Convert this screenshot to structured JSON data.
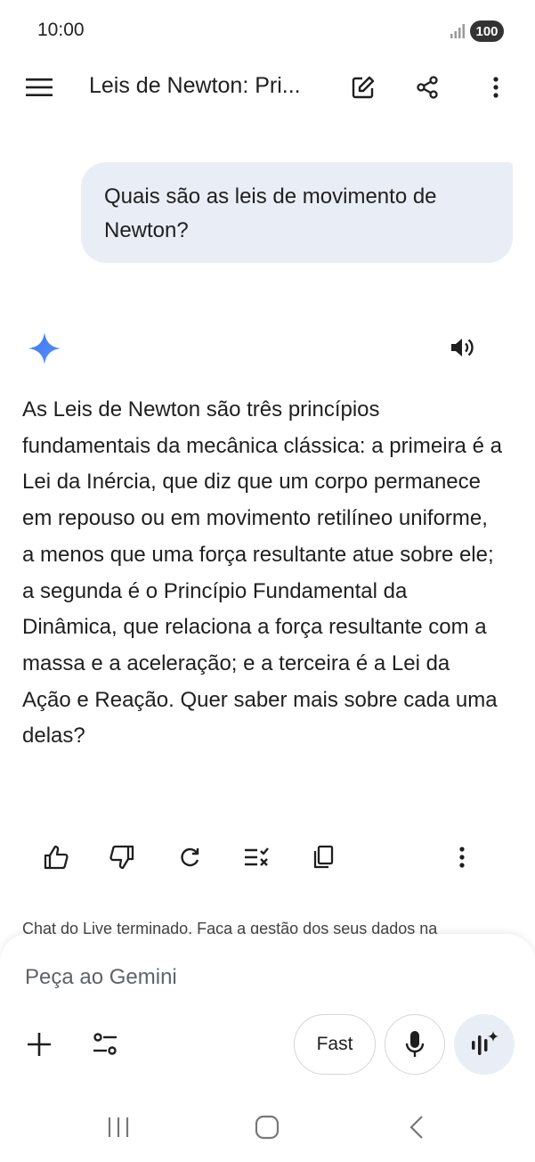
{
  "status_bar": {
    "time": "10:00",
    "battery": "100"
  },
  "header": {
    "title": "Leis de Newton: Pri..."
  },
  "user_message": {
    "text": "Quais são as leis de movimento de Newton?"
  },
  "response": {
    "text": "As Leis de Newton são três princípios fundamentais da mecânica clássica: a primeira é a Lei da Inércia, que diz que um corpo permanece em repouso ou em movimento retilíneo uniforme, a menos que uma força resultante atue sobre ele; a segunda é o Princípio Fundamental da Dinâmica, que relaciona a força resultante com a massa e a aceleração; e a terceira é a Lei da Ação e Reação. Quer saber mais sobre cada uma delas?"
  },
  "notice": {
    "text": "Chat do Live terminado. Faça a gestão dos seus dados na"
  },
  "input": {
    "placeholder": "Peça ao Gemini",
    "mode_label": "Fast"
  },
  "colors": {
    "accent": "#4285f4",
    "bubble": "#e9eef6",
    "text": "#1f1f1f"
  },
  "icons": [
    "menu-icon",
    "edit-icon",
    "share-icon",
    "more-vert-icon",
    "gemini-sparkle-icon",
    "speaker-icon",
    "thumbs-up-icon",
    "thumbs-down-icon",
    "regenerate-icon",
    "modify-response-icon",
    "copy-icon",
    "plus-icon",
    "tools-icon",
    "mic-icon",
    "live-icon"
  ]
}
